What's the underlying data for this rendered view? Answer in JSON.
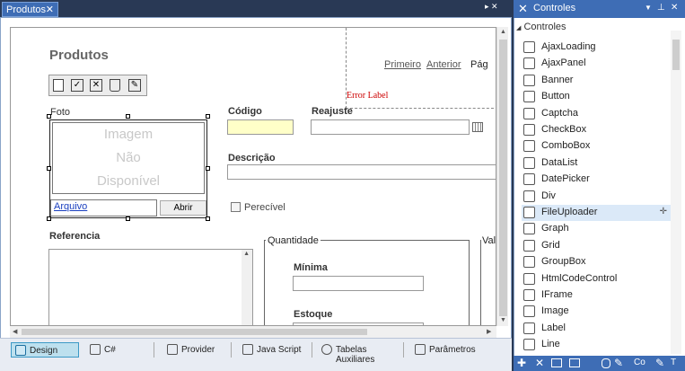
{
  "doc_tab": {
    "title": "Produtos",
    "close": "✕"
  },
  "page": {
    "title": "Produtos",
    "pager": {
      "first": "Primeiro",
      "prev": "Anterior",
      "page": "Pág"
    },
    "error_label": "Error Label",
    "foto_label": "Foto",
    "image_placeholder": [
      "Imagem",
      "Não",
      "Disponível"
    ],
    "file_link": "Arquivo",
    "open_button": "Abrir",
    "codigo_label": "Código",
    "reajuste_label": "Reajuste",
    "descricao_label": "Descrição",
    "perecivel_label": "Perecível",
    "referencia_label": "Referencia",
    "quantidade_label": "Quantidade",
    "minima_label": "Mínima",
    "estoque_label": "Estoque",
    "valor_label": "Valo"
  },
  "bottom_tabs": [
    "Design",
    "C#",
    "Provider",
    "Java Script",
    "Tabelas Auxiliares",
    "Parâmetros"
  ],
  "panel": {
    "title": "Controles",
    "group": "Controles",
    "items": [
      "AjaxLoading",
      "AjaxPanel",
      "Banner",
      "Button",
      "Captcha",
      "CheckBox",
      "ComboBox",
      "DataList",
      "DatePicker",
      "Div",
      "FileUploader",
      "Graph",
      "Grid",
      "GroupBox",
      "HtmlCodeControl",
      "IFrame",
      "Image",
      "Label",
      "Line"
    ],
    "selected": "FileUploader",
    "bottom": [
      "Co",
      "T"
    ]
  },
  "colors": {
    "accent": "#3e6db5",
    "code_bg": "#ffffc8",
    "error": "#cc0000",
    "selected_tab": "#bde0ee"
  }
}
